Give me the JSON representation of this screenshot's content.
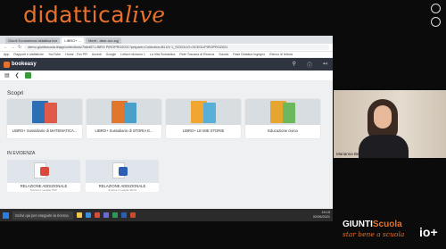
{
  "brand": {
    "part1": "didattica",
    "part2": "live"
  },
  "browser": {
    "tabs": [
      "Giunti Ecosistema didattica live",
      "LIBRO+ ...",
      "Meet - dem-ocr-sqj"
    ],
    "url": "demo.giuntiscuola.it/app/collections/7ldlz6f7-LIBRO PIROPRO2021?prepare=Collection=BLUV 1_SCEGLIO=SCEGLIPIROPRO2021",
    "nav": [
      "←",
      "→",
      "↻"
    ],
    "bookmarks": [
      "App",
      "Rapporti e statistiche",
      "YouTube",
      "Home - Fox PR",
      "Accedi",
      "Google",
      "Letture diciamo 1",
      "La Vita Scolastica",
      "Rete Toscana di Ricerca",
      "Scuola",
      "Fase Didatica Ingegno",
      "Elenco di lettura"
    ]
  },
  "app": {
    "name": "bookeasy",
    "colors": {
      "accent": "#e8702a",
      "appbar": "#2e3440"
    },
    "sections": {
      "scopri": {
        "title": "Scopri",
        "items": [
          {
            "label": "LIBRO+ Sussidiario di MATEMATICA...",
            "color": "#2d6fb5"
          },
          {
            "label": "LIBRO+ Sussidiario di STORIA E...",
            "color": "#e0772c"
          },
          {
            "label": "LIBRO+ LE MIE STORIE",
            "color": "#f0a630"
          },
          {
            "label": "Educazione civica",
            "color": "#e5a52e"
          }
        ]
      },
      "evidenza": {
        "title": "IN EVIDENZA",
        "items": [
          {
            "label": "RELAZIONE ADDIZIONALE",
            "sub": "Scarica il modello PDF",
            "badge_color": "#d9483b"
          },
          {
            "label": "RELAZIONE ADDIZIONALE",
            "sub": "Scarica il modello Word",
            "badge_color": "#2b5fb5"
          }
        ]
      }
    }
  },
  "taskbar": {
    "search_placeholder": "Scrivi qui per eseguire la ricerca",
    "time": "16:15",
    "date": "02/06/2021"
  },
  "webcam": {
    "name": "Marianna Bernardini"
  },
  "footer": {
    "giunti": "GIUNTI",
    "scuola": "Scuola",
    "tagline": "star bene a scuola",
    "io": "io+"
  }
}
